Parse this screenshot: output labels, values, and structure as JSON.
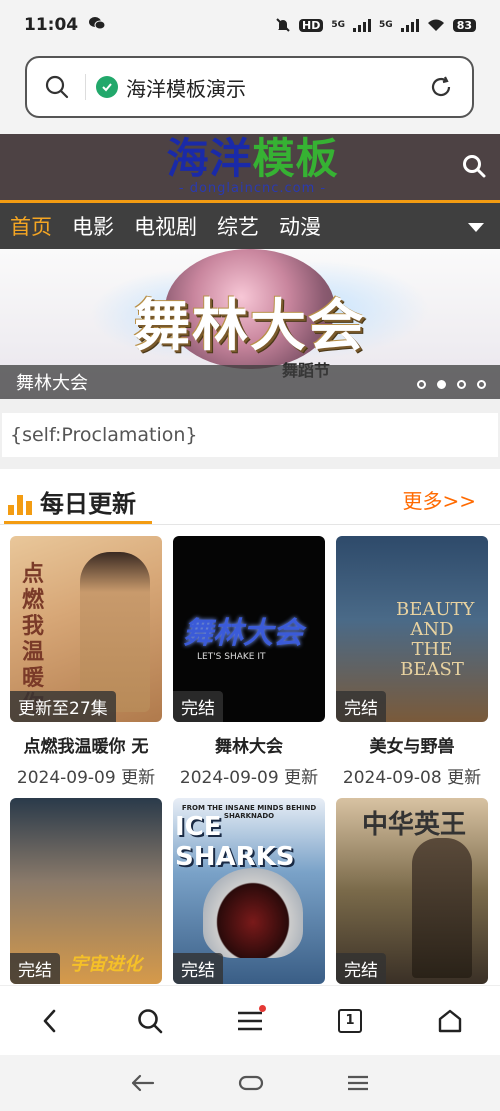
{
  "status": {
    "time": "11:04",
    "battery": "83",
    "net1": "5G",
    "net2": "5G",
    "hd": "HD"
  },
  "browser": {
    "page_title": "海洋模板演示",
    "tab_count": "1"
  },
  "site": {
    "logo_line1_a": "海洋",
    "logo_line1_b": "模板",
    "logo_line2": "- donglaincnc.com -"
  },
  "nav": {
    "items": [
      "首页",
      "电影",
      "电视剧",
      "综艺",
      "动漫"
    ],
    "active": "首页"
  },
  "banner": {
    "title": "舞林大会",
    "caption": "舞林大会",
    "sub": "舞蹈节",
    "slides": 4,
    "active_slide": 2
  },
  "proclamation": "{self:Proclamation}",
  "section": {
    "title": "每日更新",
    "more": "更多>>"
  },
  "cards": [
    {
      "name": "点燃我温暖你 无",
      "date": "2024-09-09 更新",
      "badge": "更新至27集",
      "poster_text": "点燃我温暖你"
    },
    {
      "name": "舞林大会",
      "date": "2024-09-09 更新",
      "badge": "完结",
      "poster_text": "舞林大会",
      "poster_sub": "LET'S SHAKE IT"
    },
    {
      "name": "美女与野兽",
      "date": "2024-09-08 更新",
      "badge": "完结",
      "poster_text": "BEAUTY AND THE BEAST"
    },
    {
      "badge": "完结",
      "poster_text": "宇宙进化"
    },
    {
      "badge": "完结",
      "poster_text": "ICE SHARKS",
      "poster_top": "FROM THE INSANE MINDS BEHIND SHARKNADO"
    },
    {
      "badge": "完结",
      "poster_text": "中华英王"
    }
  ]
}
